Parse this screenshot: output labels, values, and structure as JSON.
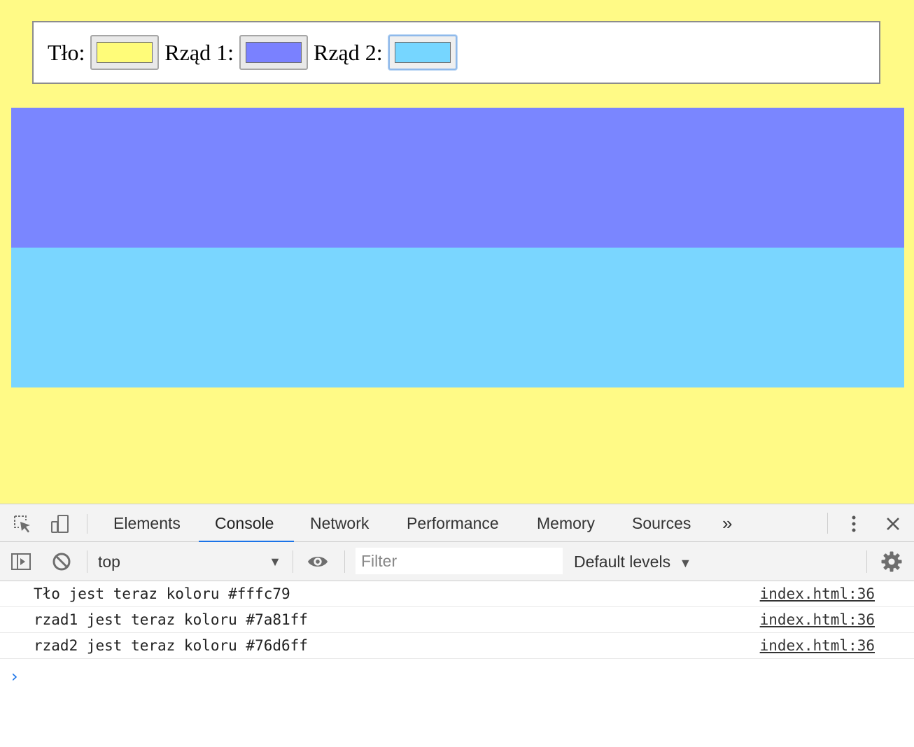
{
  "page": {
    "background_color": "#fffa86",
    "controls": [
      {
        "label": "Tło:",
        "color": "#fffc79"
      },
      {
        "label": "Rząd 1:",
        "color": "#7a81ff"
      },
      {
        "label": "Rząd 2:",
        "color": "#76d6ff"
      }
    ],
    "row1_color": "#7a86ff",
    "row2_color": "#7ad6ff"
  },
  "devtools": {
    "tabs": [
      "Elements",
      "Console",
      "Network",
      "Performance",
      "Memory",
      "Sources"
    ],
    "active_tab": "Console",
    "icons": {
      "inspect": "inspect-element-icon",
      "device": "device-toolbar-icon",
      "more_tabs": "chevron-double-right-icon",
      "kebab": "more-options-icon",
      "close": "close-icon",
      "sidebar": "sidebar-toggle-icon",
      "clear": "clear-console-icon",
      "eye": "live-expression-icon",
      "settings": "gear-icon"
    },
    "more_tabs_glyph": "»",
    "toolbar": {
      "context": "top",
      "filter_placeholder": "Filter",
      "levels": "Default levels"
    },
    "messages": [
      {
        "text": "Tło jest teraz koloru #fffc79",
        "source": "index.html:36"
      },
      {
        "text": "rzad1 jest teraz koloru #7a81ff",
        "source": "index.html:36"
      },
      {
        "text": "rzad2 jest teraz koloru #76d6ff",
        "source": "index.html:36"
      }
    ],
    "prompt_glyph": "›"
  }
}
